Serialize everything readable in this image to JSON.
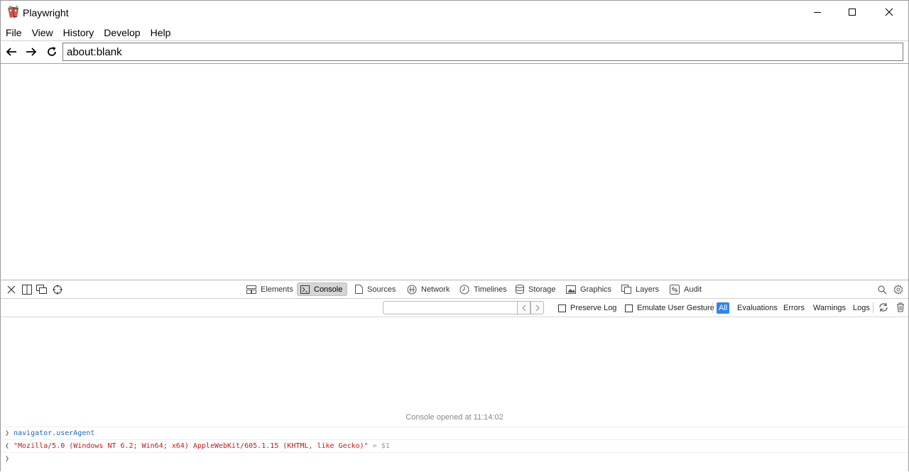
{
  "window": {
    "title": "Playwright",
    "minimize_icon": "minimize-icon",
    "maximize_icon": "maximize-icon",
    "close_icon": "close-icon"
  },
  "menu": [
    "File",
    "View",
    "History",
    "Develop",
    "Help"
  ],
  "nav": {
    "url": "about:blank"
  },
  "devtools": {
    "tabs": [
      {
        "label": "Elements",
        "icon": "elements-icon"
      },
      {
        "label": "Console",
        "icon": "console-icon"
      },
      {
        "label": "Sources",
        "icon": "sources-icon"
      },
      {
        "label": "Network",
        "icon": "network-icon"
      },
      {
        "label": "Timelines",
        "icon": "timelines-icon"
      },
      {
        "label": "Storage",
        "icon": "storage-icon"
      },
      {
        "label": "Graphics",
        "icon": "graphics-icon"
      },
      {
        "label": "Layers",
        "icon": "layers-icon"
      },
      {
        "label": "Audit",
        "icon": "audit-icon"
      }
    ],
    "active_tab": "Console",
    "filter": {
      "value": "",
      "preserve_log": "Preserve Log",
      "emulate_gesture": "Emulate User Gesture",
      "levels": [
        "All",
        "Evaluations",
        "Errors",
        "Warnings",
        "Logs"
      ],
      "active_level": "All"
    },
    "console": {
      "opened": "Console opened at 11:14:02",
      "command": "navigator.userAgent",
      "result": "\"Mozilla/5.0 (Windows NT 6.2; Win64; x64) AppleWebKit/605.1.15 (KHTML, like Gecko)\"",
      "result_index": "= $1"
    }
  },
  "colors": {
    "accent": "#2f86ea",
    "result_text": "#c41a16",
    "command_text": "#1d68c4"
  }
}
